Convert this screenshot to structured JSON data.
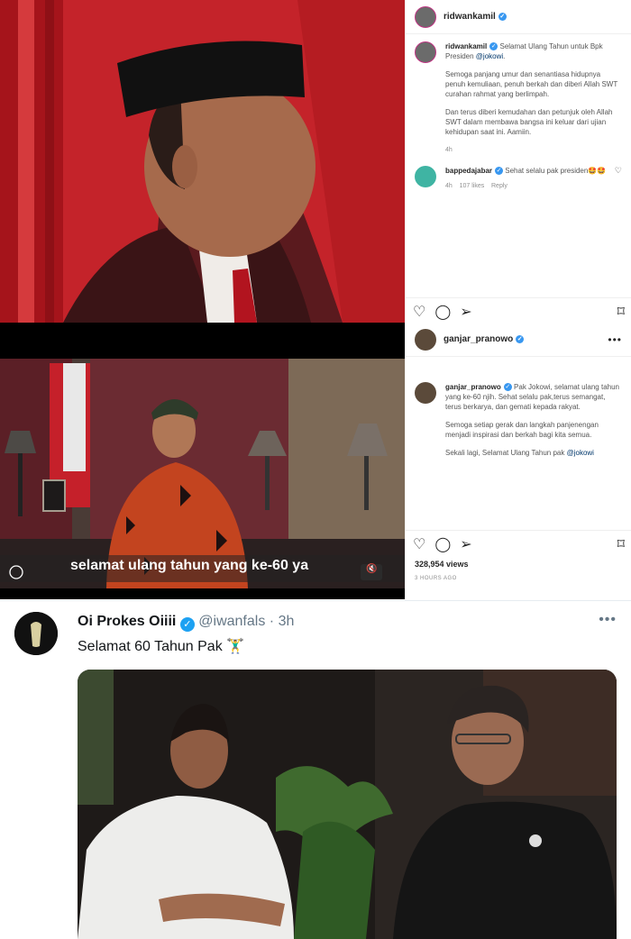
{
  "post1": {
    "username": "ridwankamil",
    "caption_username": "ridwankamil",
    "caption_p1_pre": "Selamat Ulang Tahun untuk Bpk Presiden ",
    "caption_mention": "@jokowi",
    "caption_p1_post": ".",
    "caption_p2": "Semoga panjang umur dan senantiasa hidupnya penuh kemuliaan, penuh berkah dan diberi Allah SWT curahan rahmat yang berlimpah.",
    "caption_p3": "Dan terus diberi kemudahan dan petunjuk oleh Allah SWT dalam membawa bangsa ini keluar dari ujian kehidupan saat ini. Aamiin.",
    "caption_time": "4h",
    "comment_user": "bappedajabar",
    "comment_text": "Sehat selalu pak presiden🤩🤩",
    "comment_time": "4h",
    "comment_likes": "107 likes",
    "comment_reply": "Reply"
  },
  "post2": {
    "username": "ganjar_pranowo",
    "caption_username": "ganjar_pranowo",
    "caption_p1_pre": "Pak Jokowi, selamat ulang tahun yang ke-60 njih. Sehat selalu pak,terus semangat, terus berkarya, dan gemati kepada rakyat.",
    "caption_p2": "Semoga setiap gerak dan langkah panjenengan menjadi inspirasi dan berkah bagi kita semua.",
    "caption_p3_pre": "Sekali lagi, Selamat Ulang Tahun pak ",
    "caption_mention": "@jokowi",
    "video_subtitle": "selamat ulang tahun yang ke-60 ya",
    "views": "328,954 views",
    "time_ago": "3 HOURS AGO"
  },
  "tweet": {
    "display_name": "Oi Prokes Oiiii",
    "handle": "@iwanfals",
    "separator": "·",
    "time": "3h",
    "text": "Selamat 60 Tahun Pak 🏋️‍♂️",
    "more": "•••"
  },
  "icons": {
    "verified": "✓",
    "heart": "♡",
    "comment": "◯",
    "share": "➢",
    "bookmark": "⌑",
    "more": "•••"
  }
}
